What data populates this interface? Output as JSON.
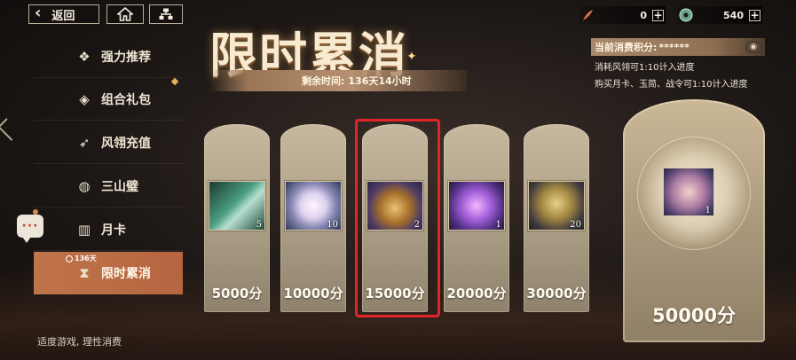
{
  "topbar": {
    "back_label": "返回",
    "home_icon": "home-icon",
    "map_icon": "map-icon"
  },
  "currencies": [
    {
      "icon": "feather-icon",
      "value": "0"
    },
    {
      "icon": "jade-coin-icon",
      "value": "540"
    }
  ],
  "sidebar": {
    "items": [
      {
        "label": "强力推荐",
        "icon": "star-emblem-icon"
      },
      {
        "label": "组合礼包",
        "icon": "gift-bundle-icon"
      },
      {
        "label": "风翎充值",
        "icon": "wing-icon"
      },
      {
        "label": "三山璧",
        "icon": "jade-disk-icon"
      },
      {
        "label": "月卡",
        "icon": "card-icon"
      },
      {
        "label": "限时累消",
        "icon": "hourglass-icon",
        "badge": "136天"
      }
    ],
    "active_index": 5
  },
  "banner": {
    "title": "限时累消",
    "time_label": "剩余时间:",
    "time_value": "136天14小时"
  },
  "points": {
    "label": "当前消费积分:",
    "value": "******",
    "rules": [
      "消耗风翎可1:10计入进度",
      "购买月卡、玉简、战令可1:10计入进度"
    ]
  },
  "rewards": [
    {
      "count": "5",
      "points": "5000分",
      "item": "green-gem-icon"
    },
    {
      "count": "10",
      "points": "10000分",
      "item": "pearl-orb-icon"
    },
    {
      "count": "2",
      "points": "15000分",
      "item": "golden-crystal-icon"
    },
    {
      "count": "1",
      "points": "20000分",
      "item": "purple-crystal-icon"
    },
    {
      "count": "20",
      "points": "30000分",
      "item": "golden-statue-icon"
    }
  ],
  "grand_reward": {
    "count": "1",
    "points": "50000分",
    "item": "scroll-book-icon"
  },
  "highlighted_reward_index": 2,
  "footer_note": "适度游戏, 理性消费",
  "colors": {
    "active_tab": "#c0744b",
    "highlight": "#e3242b",
    "card": "#c7b99f"
  }
}
